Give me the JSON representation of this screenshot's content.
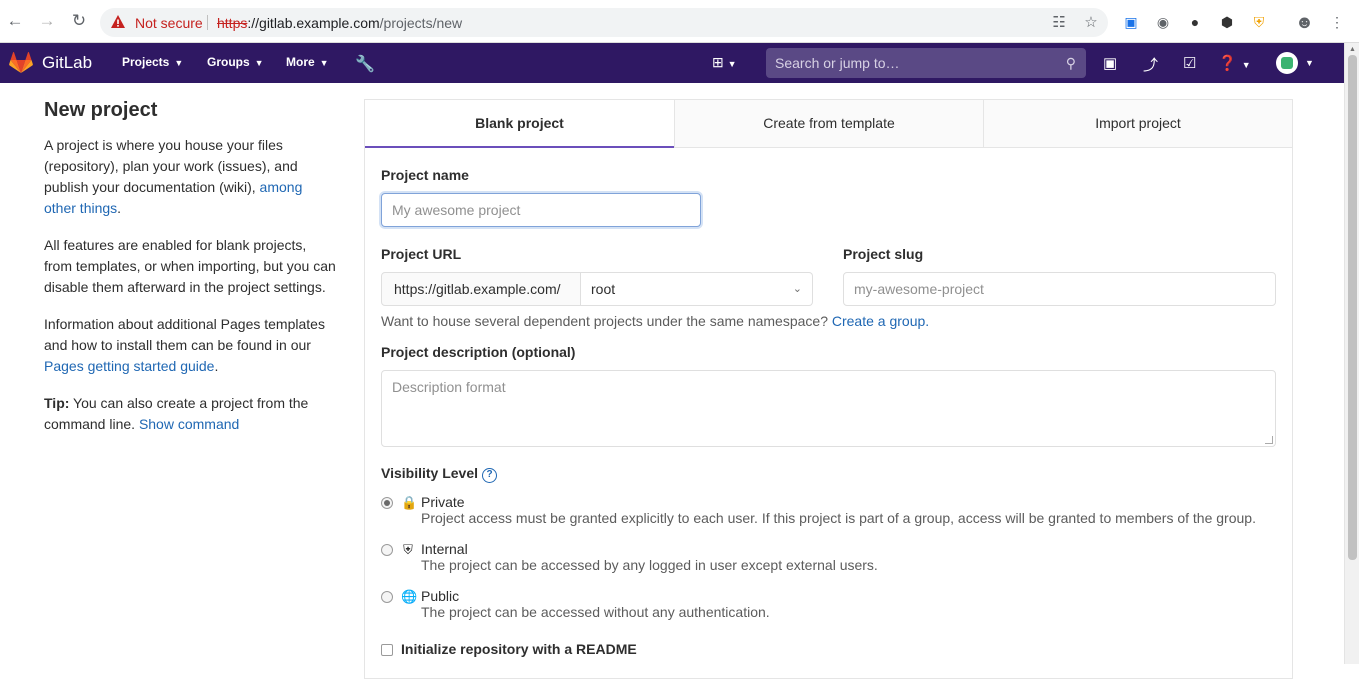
{
  "browser": {
    "not_secure": "Not secure",
    "url_scheme": "https",
    "url_host": "://gitlab.example.com",
    "url_path": "/projects/new"
  },
  "header": {
    "brand": "GitLab",
    "menu": [
      "Projects",
      "Groups",
      "More"
    ],
    "search_placeholder": "Search or jump to…",
    "brand_color": "#2f1863"
  },
  "sidebar": {
    "title": "New project",
    "p1_text": "A project is where you house your files (repository), plan your work (issues), and publish your documentation (wiki), ",
    "p1_link": "among other things",
    "p1_end": ".",
    "p2_text": "All features are enabled for blank projects, from templates, or when importing, but you can disable them afterward in the project settings.",
    "p3_text": "Information about additional Pages templates and how to install them can be found in our ",
    "p3_link": "Pages getting started guide",
    "p3_end": ".",
    "tip_label": "Tip:",
    "tip_text": " You can also create a project from the command line. ",
    "tip_link": "Show command"
  },
  "tabs": [
    "Blank project",
    "Create from template",
    "Import project"
  ],
  "form": {
    "name_label": "Project name",
    "name_placeholder": "My awesome project",
    "url_label": "Project URL",
    "url_prefix": "https://gitlab.example.com/",
    "namespace": "root",
    "slug_label": "Project slug",
    "slug_placeholder": "my-awesome-project",
    "group_help": "Want to house several dependent projects under the same namespace? ",
    "group_link": "Create a group.",
    "desc_label": "Project description (optional)",
    "desc_placeholder": "Description format",
    "visibility_label": "Visibility Level",
    "visibility": [
      {
        "title": "Private",
        "desc": "Project access must be granted explicitly to each user. If this project is part of a group, access will be granted to members of the group.",
        "checked": true
      },
      {
        "title": "Internal",
        "desc": "The project can be accessed by any logged in user except external users.",
        "checked": false
      },
      {
        "title": "Public",
        "desc": "The project can be accessed without any authentication.",
        "checked": false
      }
    ],
    "readme_label": "Initialize repository with a README"
  }
}
